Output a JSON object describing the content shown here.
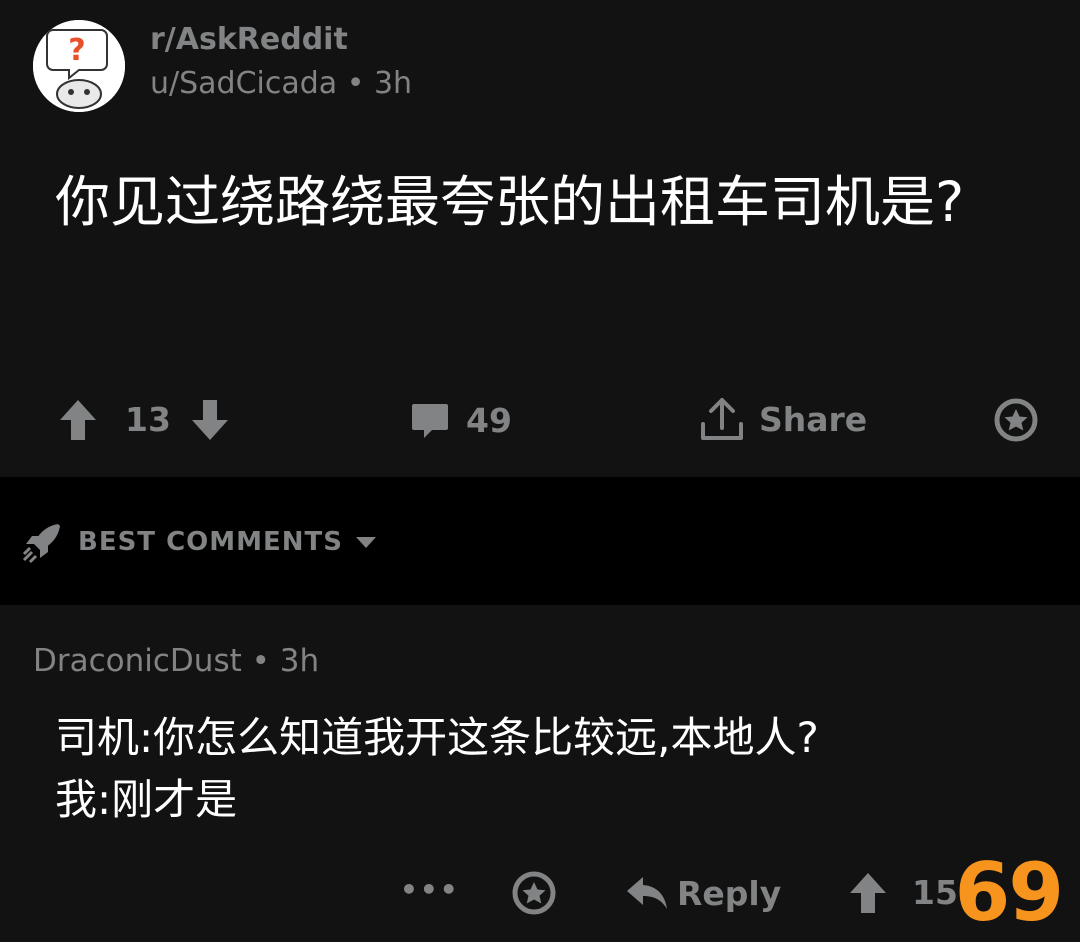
{
  "post": {
    "subreddit": "r/AskReddit",
    "author": "u/SadCicada",
    "time": "3h",
    "title": "你见过绕路绕最夸张的出租车司机是?",
    "upvotes": "13",
    "comments": "49",
    "share_label": "Share"
  },
  "sort": {
    "label": "BEST COMMENTS"
  },
  "comment": {
    "author": "DraconicDust",
    "time": "3h",
    "line1": "司机:你怎么知道我开这条比较远,本地人?",
    "line2": "我:刚才是",
    "reply_label": "Reply",
    "votes": "15",
    "more": "•••"
  },
  "badge": "69",
  "colors": {
    "background": "#121212",
    "muted": "#818384",
    "badge": "#f7941d"
  }
}
